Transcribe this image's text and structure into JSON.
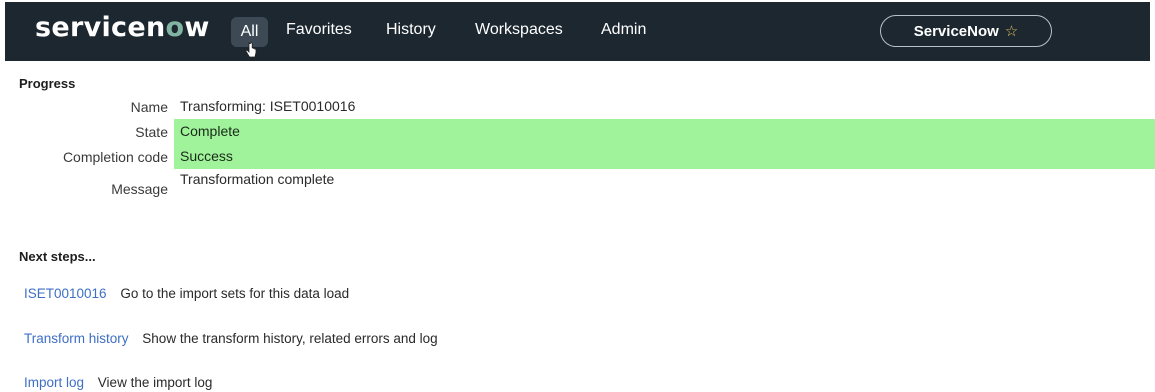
{
  "header": {
    "logo_text": "servicenow",
    "nav": {
      "all": "All",
      "favorites": "Favorites",
      "history": "History",
      "workspaces": "Workspaces",
      "admin": "Admin"
    },
    "instance_label": "ServiceNow",
    "star_icon": "☆"
  },
  "progress": {
    "title": "Progress",
    "name_label": "Name",
    "name_value": "Transforming: ISET0010016",
    "state_label": "State",
    "state_value": "Complete",
    "completion_label": "Completion code",
    "completion_value": "Success",
    "message_label": "Message",
    "message_value": "Transformation complete"
  },
  "next_steps": {
    "title": "Next steps...",
    "items": [
      {
        "link": "ISET0010016",
        "description": "Go to the import sets for this data load"
      },
      {
        "link": "Transform history",
        "description": "Show the transform history, related errors and log"
      },
      {
        "link": "Import log",
        "description": "View the import log"
      }
    ]
  },
  "colors": {
    "navbar_bg": "#1c2730",
    "highlight_green": "#a0f39a",
    "link_blue": "#3d6fc4",
    "logo_accent": "#81b5a1"
  }
}
